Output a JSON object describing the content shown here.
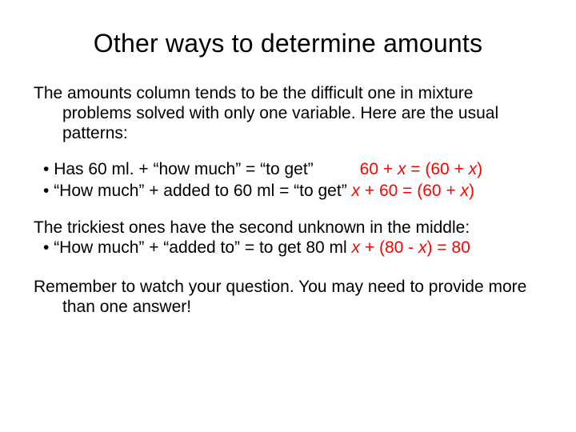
{
  "title": "Other ways to determine amounts",
  "intro": "The amounts column tends to be the difficult one in mixture problems solved with only one variable.  Here are the usual patterns:",
  "bullets": [
    {
      "text": "Has 60 ml. + “how much” = “to get”",
      "eq_pre": "60 + ",
      "eq_x1": "x",
      "eq_mid": " = (60 + ",
      "eq_x2": "x",
      "eq_post": ")"
    },
    {
      "text": "“How much” + added to 60 ml = “to get” ",
      "eq_x1": "x",
      "eq_mid": " + 60 = (60 + ",
      "eq_x2": "x",
      "eq_post": ")"
    }
  ],
  "tricky_lead": "The trickiest ones have the second unknown in the middle:",
  "tricky_bullet": {
    "text": "“How much” + “added to” = to get 80 ml ",
    "eq_x1": "x",
    "eq_mid": " + (80 - ",
    "eq_x2": "x",
    "eq_post": ") = 80"
  },
  "reminder": "Remember to watch your question. You may need to provide more than one answer!"
}
